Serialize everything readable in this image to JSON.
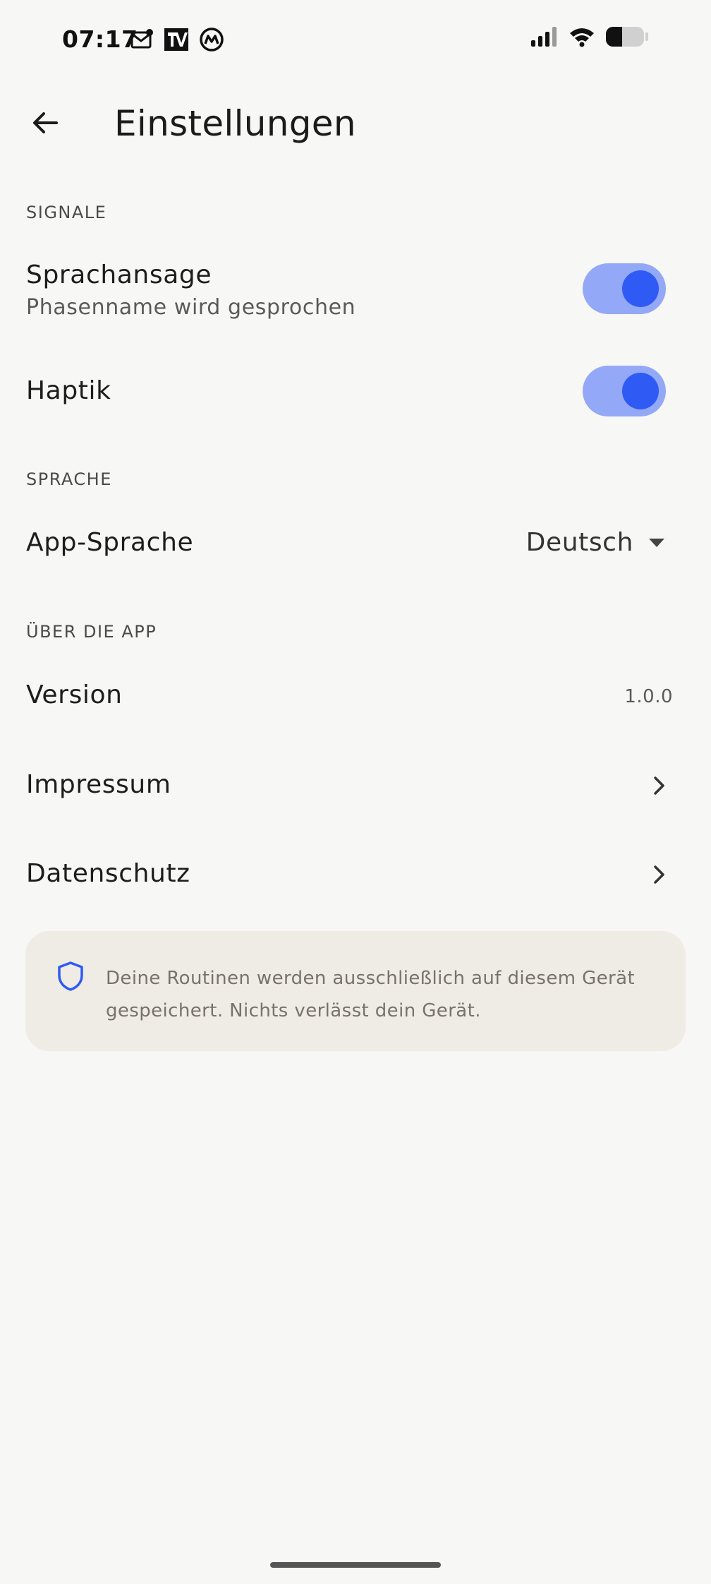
{
  "status_bar": {
    "time": "07:17",
    "left_icons": [
      "mail-icon",
      "app-logo-icon",
      "coin-icon"
    ],
    "right_icons": [
      "signal-icon",
      "wifi-icon",
      "battery-icon"
    ]
  },
  "app_bar": {
    "back_icon": "arrow-left-icon",
    "title": "Einstellungen"
  },
  "sections": {
    "signals": {
      "header": "SIGNALE",
      "voice": {
        "title": "Sprachansage",
        "subtitle": "Phasenname wird gesprochen",
        "enabled": true
      },
      "haptics": {
        "title": "Haptik",
        "enabled": true
      }
    },
    "language": {
      "header": "SPRACHE",
      "app_language": {
        "title": "App-Sprache",
        "selected": "Deutsch"
      }
    },
    "about": {
      "header": "ÜBER DIE APP",
      "version": {
        "title": "Version",
        "value": "1.0.0"
      },
      "imprint": {
        "title": "Impressum"
      },
      "privacy": {
        "title": "Datenschutz"
      }
    }
  },
  "info_card": {
    "icon": "shield-icon",
    "text": "Deine Routinen werden ausschließlich auf diesem Gerät gespeichert. Nichts verlässt dein Gerät."
  },
  "colors": {
    "background": "#f7f7f5",
    "accent": "#2f5af3",
    "toggle_track": "#93a8f6",
    "card_background": "#efebe5"
  }
}
